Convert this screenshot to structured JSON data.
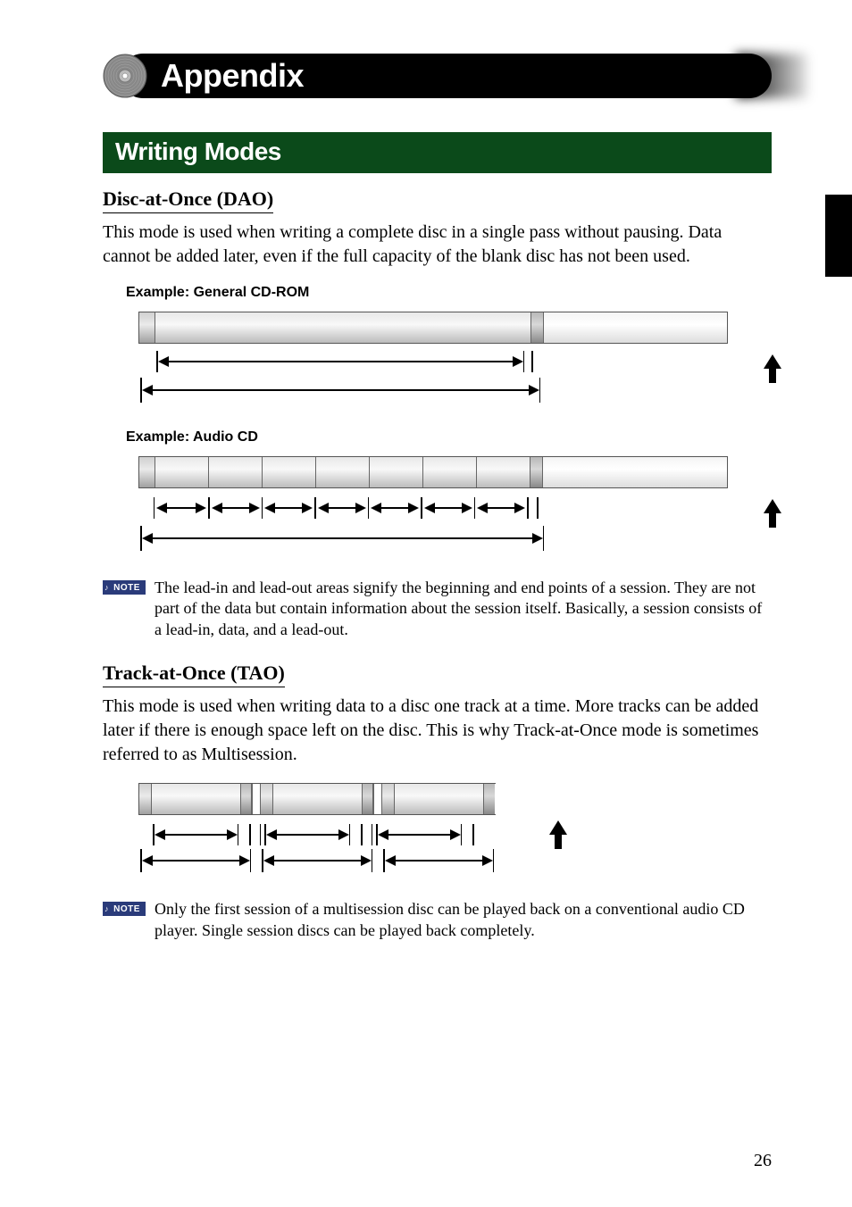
{
  "appendix_title": "Appendix",
  "section_title": "Writing Modes",
  "dao": {
    "heading": "Disc-at-Once (DAO)",
    "body": "This mode is used when writing a complete disc in a single pass without pausing. Data cannot be added later, even if the full capacity of the blank disc has not been used.",
    "example1_label": "Example: General CD-ROM",
    "example2_label": "Example:  Audio CD",
    "note": "The lead-in and lead-out areas signify the beginning and end points of a session.  They are not part of the data but contain information about the session itself.  Basically, a session consists of a lead-in, data, and a lead-out."
  },
  "tao": {
    "heading": "Track-at-Once (TAO)",
    "body": "This mode is used when writing data to a disc one track at a time.  More tracks can be added later if there is enough space left on the disc.  This is why Track-at-Once mode is sometimes referred to as Multisession.",
    "note": "Only the first session of a multisession disc can be played back on a conventional audio CD player.  Single session discs can be played back completely."
  },
  "note_badge": "NOTE",
  "page_number": "26"
}
